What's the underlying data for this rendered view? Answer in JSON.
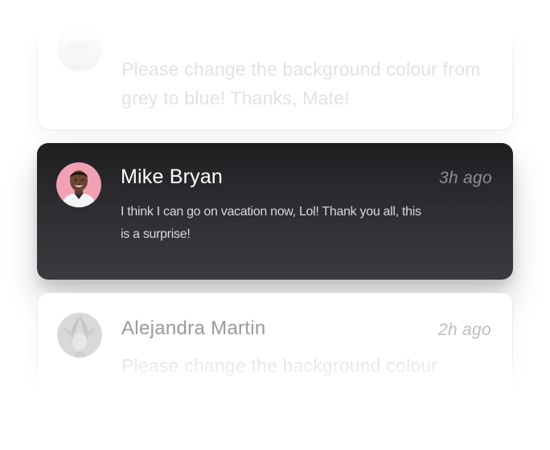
{
  "notifications": [
    {
      "message": "Please change the background colour from grey to blue! Thanks, Mate!",
      "state": "faded"
    },
    {
      "name": "Mike Bryan",
      "time": "3h ago",
      "message": "I think I can go on vacation now, Lol! Thank you all, this is a surprise!",
      "state": "active",
      "avatar_bg": "#f0a1b3"
    },
    {
      "name": "Alejandra Martin",
      "time": "2h ago",
      "message": "Please change the background colour",
      "state": "faded"
    }
  ],
  "colors": {
    "active_card_bg": "#2d2d31",
    "active_name": "#ffffff",
    "active_time": "#8d8d93",
    "faded_text": "#e2e2e2"
  }
}
